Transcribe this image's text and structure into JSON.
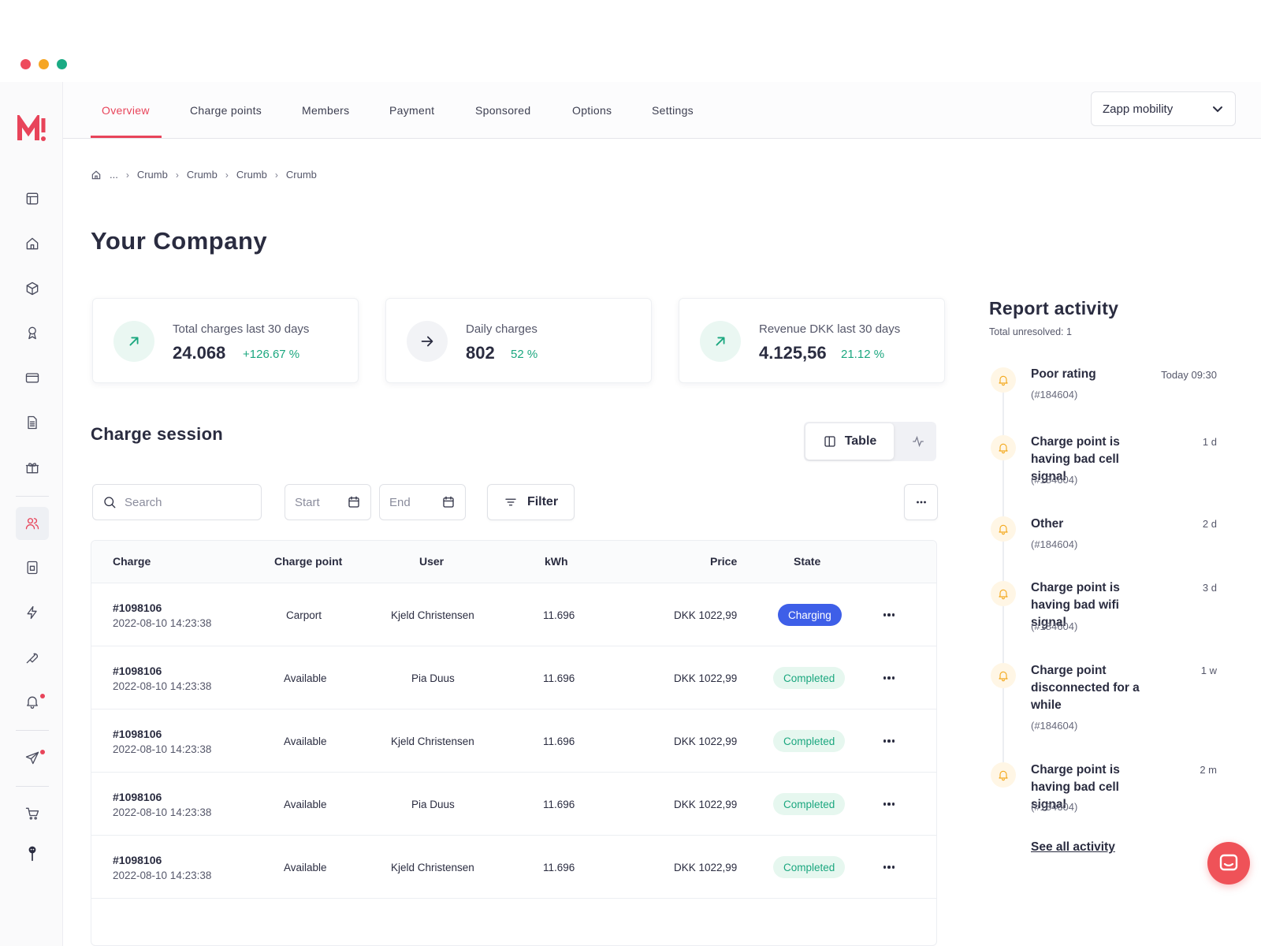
{
  "window": {
    "dot_colors": [
      "#ee4b5c",
      "#f6a623",
      "#1bab84"
    ]
  },
  "brand": {
    "logo_icon": "m-logo-icon",
    "accent": "#e8445a"
  },
  "sidebar": {
    "icons": [
      "layout-icon",
      "home-icon",
      "box-icon",
      "award-icon",
      "credit-card-icon",
      "document-icon",
      "gift-icon",
      "users-icon",
      "device-icon",
      "lightning-icon",
      "wrench-icon",
      "bell-icon",
      "send-icon",
      "cart-icon",
      "avatar-icon"
    ],
    "active": "users-icon"
  },
  "nav": {
    "tabs": [
      {
        "label": "Overview",
        "active": true
      },
      {
        "label": "Charge points"
      },
      {
        "label": "Members"
      },
      {
        "label": "Payment"
      },
      {
        "label": "Sponsored"
      },
      {
        "label": "Options"
      },
      {
        "label": "Settings"
      }
    ],
    "company": "Zapp mobility"
  },
  "breadcrumb": {
    "ellipsis": "...",
    "items": [
      "Crumb",
      "Crumb",
      "Crumb",
      "Crumb"
    ]
  },
  "page": {
    "title": "Your Company"
  },
  "stats": [
    {
      "label": "Total charges last 30 days",
      "value": "24.068",
      "delta": "+126.67 %",
      "icon": "arrow-up-right-icon"
    },
    {
      "label": "Daily charges",
      "value": "802",
      "delta": "52 %",
      "icon": "arrow-right-icon"
    },
    {
      "label": "Revenue DKK last 30 days",
      "value": "4.125,56",
      "delta": "21.12 %",
      "icon": "arrow-up-right-icon"
    }
  ],
  "session": {
    "title": "Charge session",
    "toggle": {
      "table_label": "Table"
    },
    "search_placeholder": "Search",
    "start_placeholder": "Start",
    "end_placeholder": "End",
    "filter_label": "Filter"
  },
  "table": {
    "headers": [
      "Charge",
      "Charge point",
      "User",
      "kWh",
      "Price",
      "State"
    ],
    "rows": [
      {
        "id": "#1098106",
        "date": "2022-08-10 14:23:38",
        "point": "Carport",
        "user": "Kjeld Christensen",
        "kwh": "11.696",
        "price": "DKK 1022,99",
        "state": "Charging"
      },
      {
        "id": "#1098106",
        "date": "2022-08-10 14:23:38",
        "point": "Available",
        "user": "Pia Duus",
        "kwh": "11.696",
        "price": "DKK 1022,99",
        "state": "Completed"
      },
      {
        "id": "#1098106",
        "date": "2022-08-10 14:23:38",
        "point": "Available",
        "user": "Kjeld Christensen",
        "kwh": "11.696",
        "price": "DKK 1022,99",
        "state": "Completed"
      },
      {
        "id": "#1098106",
        "date": "2022-08-10 14:23:38",
        "point": "Available",
        "user": "Pia Duus",
        "kwh": "11.696",
        "price": "DKK 1022,99",
        "state": "Completed"
      },
      {
        "id": "#1098106",
        "date": "2022-08-10 14:23:38",
        "point": "Available",
        "user": "Kjeld Christensen",
        "kwh": "11.696",
        "price": "DKK 1022,99",
        "state": "Completed"
      }
    ]
  },
  "report": {
    "title": "Report activity",
    "subtitle": "Total unresolved: 1",
    "items": [
      {
        "title": "Poor rating",
        "ref": "(#184604)",
        "time": "Today 09:30"
      },
      {
        "title": "Charge point is having bad cell signal",
        "ref": "(#184604)",
        "time": "1 d"
      },
      {
        "title": "Other",
        "ref": "(#184604)",
        "time": "2 d"
      },
      {
        "title": "Charge point is having bad wifi signal",
        "ref": "(#184604)",
        "time": "3 d"
      },
      {
        "title": "Charge point disconnected for a while",
        "ref": "(#184604)",
        "time": "1 w"
      },
      {
        "title": "Charge point is having bad cell signal",
        "ref": "(#184604)",
        "time": "2 m"
      }
    ],
    "see_all": "See all activity"
  },
  "colors": {
    "positive": "#1ba77f",
    "charging": "#3e5fe8",
    "warning": "#f3a81c",
    "chat": "#ef5258"
  }
}
